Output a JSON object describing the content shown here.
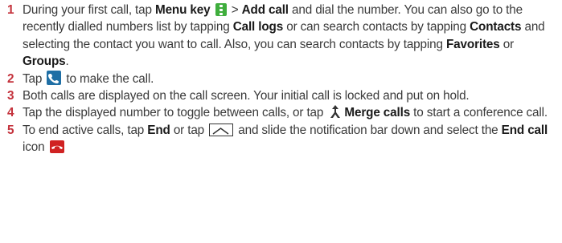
{
  "steps": [
    {
      "num": "1",
      "t1": "During your first call, tap ",
      "b1": "Menu key",
      "t2": " > ",
      "b2": "Add call",
      "t3": " and dial the number. You can also go to the recently dialled numbers list by tapping ",
      "b3": "Call logs",
      "t4": " or can search contacts by tapping ",
      "b4": "Contacts",
      "t5": " and selecting the contact you want to call. Also, you can search contacts by tapping ",
      "b5": "Favorites",
      "t6": " or ",
      "b6": "Groups",
      "t7": "."
    },
    {
      "num": "2",
      "t1": "Tap ",
      "t2": " to make the call."
    },
    {
      "num": "3",
      "t1": "Both calls are displayed on the call screen. Your initial call is locked and put on hold."
    },
    {
      "num": "4",
      "t1": "Tap the displayed number to toggle between calls, or tap ",
      "b1": "Merge calls",
      "t2": " to start a conference call."
    },
    {
      "num": "5",
      "t1": "To end active calls, tap ",
      "b1": "End",
      "t2": " or tap ",
      "t3": " and slide the notification bar down and select the ",
      "b2": "End call",
      "t4": " icon "
    }
  ],
  "icons": {
    "menu": "menu-key-icon",
    "call": "phone-call-icon",
    "merge": "merge-calls-icon",
    "home": "home-key-icon",
    "end": "end-call-icon"
  },
  "colors": {
    "step_number": "#c4323c",
    "menu_icon": "#3fae3d",
    "call_icon": "#1f6fa5",
    "end_icon": "#d02222"
  }
}
